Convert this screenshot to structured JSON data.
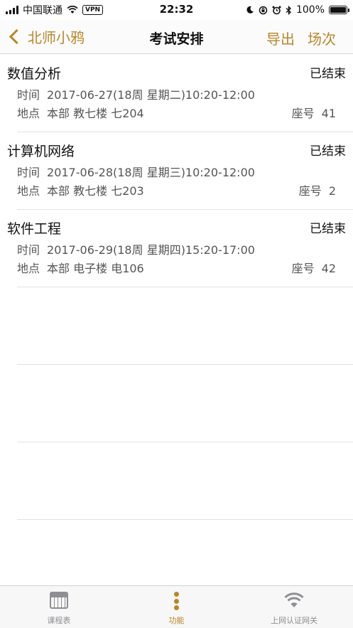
{
  "status_bar": {
    "carrier": "中国联通",
    "vpn": "VPN",
    "time": "22:32",
    "battery": "100%"
  },
  "nav": {
    "back_label": "北师小鸦",
    "title": "考试安排",
    "export_label": "导出",
    "session_label": "场次"
  },
  "exams": [
    {
      "name": "数值分析",
      "status": "已结束",
      "time_label": "时间",
      "time": "2017-06-27(18周 星期二)10:20-12:00",
      "location_label": "地点",
      "location": "本部 教七楼 七204",
      "seat_label": "座号",
      "seat": "41"
    },
    {
      "name": "计算机网络",
      "status": "已结束",
      "time_label": "时间",
      "time": "2017-06-28(18周 星期三)10:20-12:00",
      "location_label": "地点",
      "location": "本部 教七楼 七203",
      "seat_label": "座号",
      "seat": "2"
    },
    {
      "name": "软件工程",
      "status": "已结束",
      "time_label": "时间",
      "time": "2017-06-29(18周 星期四)15:20-17:00",
      "location_label": "地点",
      "location": "本部 电子楼 电106",
      "seat_label": "座号",
      "seat": "42"
    }
  ],
  "tabs": [
    {
      "label": "课程表",
      "icon": "calendar-icon",
      "active": false
    },
    {
      "label": "功能",
      "icon": "more-dots-icon",
      "active": true
    },
    {
      "label": "上网认证网关",
      "icon": "wifi-icon",
      "active": false
    }
  ],
  "colors": {
    "accent": "#b8862b",
    "inactive": "#8e8e93",
    "secondary_text": "#555555"
  }
}
